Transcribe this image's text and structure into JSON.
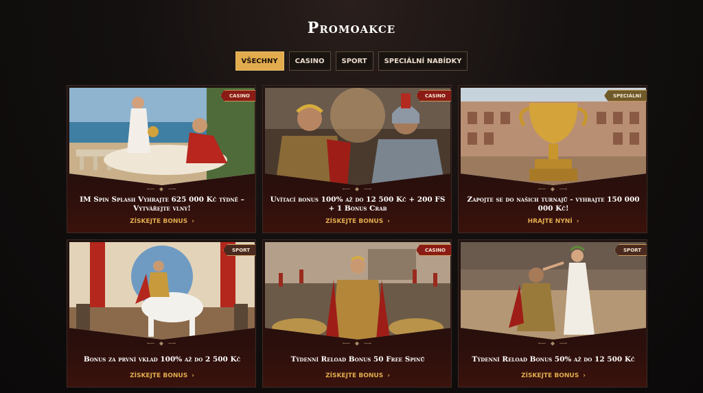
{
  "page": {
    "title": "Promoakce"
  },
  "tabs": [
    {
      "label": "VŠECHNY",
      "active": true
    },
    {
      "label": "CASINO",
      "active": false
    },
    {
      "label": "SPORT",
      "active": false
    },
    {
      "label": "SPECIÁLNÍ NABÍDKY",
      "active": false
    }
  ],
  "cards": [
    {
      "badge": "CASINO",
      "title": "IM Spin Splash Vyhrajte 625 000 Kč týdně – Vytvářejte vlny!",
      "link": "ZÍSKEJTE BONUS",
      "icon": "beach-roman-scene"
    },
    {
      "badge": "CASINO",
      "title": "Uvítací bonus 100% až do 12 500 Kč + 200 FS + 1 Bonus Crab",
      "link": "ZÍSKEJTE BONUS",
      "icon": "two-gladiators"
    },
    {
      "badge": "SPECIÁLNÍ",
      "title": "Zapojte se do našich turnajů - vyhrajte 150 000 000 Kč!",
      "link": "HRAJTE NYNÍ",
      "icon": "golden-trophy-colosseum"
    },
    {
      "badge": "SPORT",
      "title": "Bonus za první vklad 100% až do 2 500 Kč",
      "link": "ZÍSKEJTE BONUS",
      "icon": "emperor-on-horse"
    },
    {
      "badge": "CASINO",
      "title": "Týdenní Reload Bonus 50 Free Spinů",
      "link": "ZÍSKEJTE BONUS",
      "icon": "roman-general-army"
    },
    {
      "badge": "SPORT",
      "title": "Týdenní Reload Bonus 50% až do 12 500 Kč",
      "link": "ZÍSKEJTE BONUS",
      "icon": "gladiator-crowned-arena"
    }
  ],
  "colors": {
    "accent": "#e2ac4e",
    "badge_red": "#8b1c15",
    "background": "#141010"
  }
}
